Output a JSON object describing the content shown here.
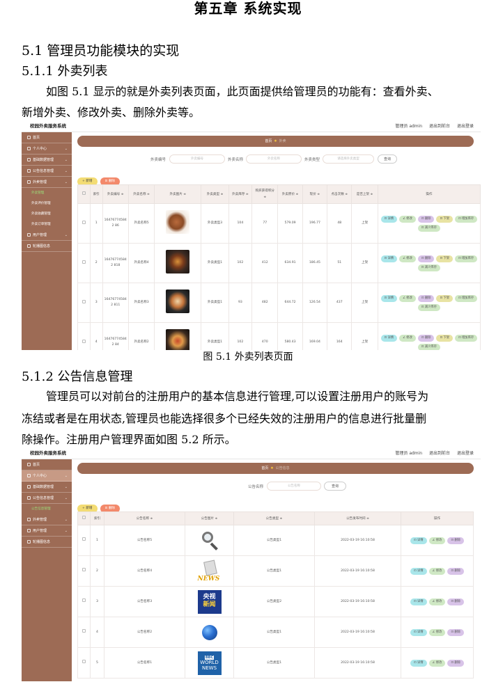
{
  "doc": {
    "chapter": "第五章  系统实现",
    "sec51": "5.1  管理员功能模块的实现",
    "sec511": "5.1.1  外卖列表",
    "p1a": "如图 5.1 显示的就是外卖列表页面，此页面提供给管理员的功能有：查看外卖、",
    "p1b": "新增外卖、修改外卖、删除外卖等。",
    "cap1": "图 5.1 外卖列表页面",
    "sec512": "5.1.2  公告信息管理",
    "p2a": "管理员可以对前台的注册用户的基本信息进行管理,可以设置注册用户的账号为",
    "p2b": "冻结或者是在用状态,管理员也能选择很多个已经失效的注册用户的信息进行批量删",
    "p2c": "除操作。注册用户管理界面如图 5.2 所示。"
  },
  "shot1": {
    "app_title": "校园外卖服务系统",
    "top_right": [
      "管理员 admin",
      "退出到前台",
      "退出登录"
    ],
    "sidebar": [
      {
        "label": "首页"
      },
      {
        "label": "个人中心",
        "sub": true
      },
      {
        "label": "基础数据管理",
        "sub": true
      },
      {
        "label": "公告信息管理",
        "sub": true
      },
      {
        "label": "外卖管理",
        "sub": true
      }
    ],
    "sidebar_subs": [
      "外卖管理",
      "外卖评价管理",
      "外卖收藏管理",
      "外卖订单管理"
    ],
    "sidebar_after": [
      {
        "label": "用户管理",
        "sub": true
      },
      {
        "label": "轮播图信息"
      }
    ],
    "breadcrumb": [
      "首页",
      "外卖"
    ],
    "search": {
      "label1": "外卖编号",
      "ph1": "外卖编号",
      "label2": "外卖名称",
      "ph2": "外卖名称",
      "label3": "外卖类型",
      "ph3": "请选择外卖类型",
      "btn": "查询"
    },
    "add": "+ 新增",
    "delete": "删除",
    "headers": [
      "",
      "索引",
      "外卖编号 ≑",
      "外卖名称 ≑",
      "外卖图片 ≑",
      "外卖类型 ≑",
      "外卖库存 ≑",
      "购买获得积分 ≑",
      "外卖原价 ≑",
      "现价 ≑",
      "点击次数 ≑",
      "是否上架 ≑",
      "操作"
    ],
    "rows": [
      {
        "idx": "1",
        "code": "164767745842 86",
        "name": "外卖名称5",
        "type": "外卖类型3",
        "stock": "104",
        "points": "77",
        "orig": "579.09",
        "price": "196.77",
        "clicks": "48",
        "status": "上架"
      },
      {
        "idx": "2",
        "code": "164767745842 818",
        "name": "外卖名称4",
        "type": "外卖类型1",
        "stock": "102",
        "points": "412",
        "orig": "634.91",
        "price": "186.45",
        "clicks": "51",
        "status": "上架"
      },
      {
        "idx": "3",
        "code": "164767745842 811",
        "name": "外卖名称3",
        "type": "外卖类型1",
        "stock": "93",
        "points": "482",
        "orig": "644.72",
        "price": "126.54",
        "clicks": "437",
        "status": "上架"
      },
      {
        "idx": "4",
        "code": "164767745842 84",
        "name": "外卖名称2",
        "type": "外卖类型1",
        "stock": "102",
        "points": "470",
        "orig": "580.43",
        "price": "169.04",
        "clicks": "164",
        "status": "上架"
      }
    ],
    "ops": {
      "detail": "⊡ 详情",
      "edit": "∠ 修改",
      "del": "⊡ 删除",
      "down": "⊡ 下架",
      "repl": "⊡ 增加库存",
      "less": "⊡ 减少库存"
    }
  },
  "shot2": {
    "app_title": "校园外卖服务系统",
    "top_right": [
      "管理员 admin",
      "退出到前台",
      "退出登录"
    ],
    "sidebar": [
      {
        "label": "首页"
      },
      {
        "label": "个人中心",
        "sub": true,
        "hl": true
      },
      {
        "label": "基础数据管理",
        "sub": true
      },
      {
        "label": "公告信息管理",
        "sub": true
      }
    ],
    "sidebar_subs": [
      "公告信息管理"
    ],
    "sidebar_after": [
      {
        "label": "外卖管理",
        "sub": true
      },
      {
        "label": "用户管理",
        "sub": true
      },
      {
        "label": "轮播图信息"
      }
    ],
    "breadcrumb": [
      "首页",
      "公告信息"
    ],
    "search": {
      "label1": "公告名称",
      "ph1": "公告名称",
      "btn": "查询"
    },
    "add": "+ 新增",
    "delete": "删除",
    "headers": [
      "",
      "索引",
      "公告名称 ≑",
      "公告图片 ≑",
      "公告类型 ≑",
      "公告发布时间 ≑",
      "操作"
    ],
    "rows": [
      {
        "idx": "1",
        "name": "公告名称5",
        "type": "公告类型1",
        "time": "2022-03-19 16:10:58"
      },
      {
        "idx": "2",
        "name": "公告名称4",
        "type": "公告类型1",
        "time": "2022-03-19 16:10:58"
      },
      {
        "idx": "3",
        "name": "公告名称3",
        "type": "公告类型2",
        "time": "2022-03-19 16:10:58"
      },
      {
        "idx": "4",
        "name": "公告名称2",
        "type": "公告类型1",
        "time": "2022-03-19 16:10:58"
      },
      {
        "idx": "5",
        "name": "公告名称1",
        "type": "公告类型1",
        "time": "2022-03-19 16:10:58"
      }
    ],
    "img3_l1": "央视",
    "img3_l2": "新闻",
    "img2": "NEWS",
    "img5_bbc": "BBC",
    "img5_l1": "WORLD",
    "img5_l2": "NEWS",
    "ops": {
      "detail": "⊡ 详情",
      "edit": "∠ 修改",
      "del": "⊡ 删除"
    }
  }
}
